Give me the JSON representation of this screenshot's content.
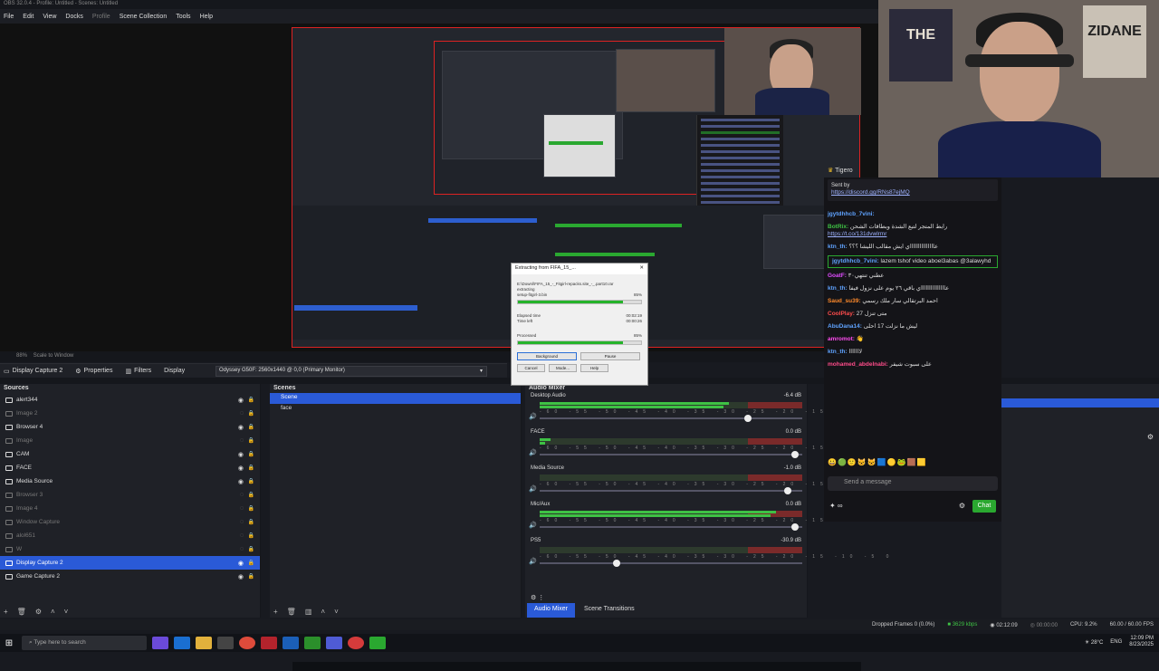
{
  "window": {
    "title": "OBS 32.0.4 - Profile: Untitled - Scenes: Untitled"
  },
  "menu": {
    "items": [
      {
        "label": "File",
        "enabled": true
      },
      {
        "label": "Edit",
        "enabled": true
      },
      {
        "label": "View",
        "enabled": true
      },
      {
        "label": "Docks",
        "enabled": true
      },
      {
        "label": "Profile",
        "enabled": false
      },
      {
        "label": "Scene Collection",
        "enabled": true
      },
      {
        "label": "Tools",
        "enabled": true
      },
      {
        "label": "Help",
        "enabled": true
      }
    ]
  },
  "preview": {
    "zoom_label": "88%",
    "scale_label": "Scale to Window"
  },
  "toolbar": {
    "source_name": "Display Capture 2",
    "properties_label": "Properties",
    "filters_label": "Filters",
    "display_label": "Display",
    "display_value": "Odyssey G50F: 2560x1440 @ 0,0 (Primary Monitor)"
  },
  "sources": {
    "title": "Sources",
    "items": [
      {
        "label": "alert344",
        "visible": true,
        "selected": false
      },
      {
        "label": "Image 2",
        "visible": false,
        "selected": false
      },
      {
        "label": "Browser 4",
        "visible": true,
        "selected": false
      },
      {
        "label": "Image",
        "visible": false,
        "selected": false
      },
      {
        "label": "CAM",
        "visible": true,
        "selected": false
      },
      {
        "label": "FACE",
        "visible": true,
        "selected": false
      },
      {
        "label": "Media Source",
        "visible": true,
        "selected": false
      },
      {
        "label": "Browser 3",
        "visible": false,
        "selected": false
      },
      {
        "label": "Image 4",
        "visible": false,
        "selected": false
      },
      {
        "label": "Window Capture",
        "visible": false,
        "selected": false
      },
      {
        "label": "alol651",
        "visible": false,
        "selected": false
      },
      {
        "label": "W",
        "visible": false,
        "selected": false
      },
      {
        "label": "Display Capture 2",
        "visible": true,
        "selected": true
      },
      {
        "label": "Game Capture 2",
        "visible": true,
        "selected": false
      }
    ]
  },
  "scenes": {
    "title": "Scenes",
    "items": [
      {
        "label": "Scene",
        "selected": true
      },
      {
        "label": "face",
        "selected": false
      }
    ]
  },
  "mixer": {
    "title": "Audio Mixer",
    "channels": [
      {
        "name": "Desktop Audio",
        "db": "-6.4 dB",
        "level": 0.72,
        "fader": 0.78
      },
      {
        "name": "FACE",
        "db": "0.0 dB",
        "level": 0.04,
        "fader": 0.96
      },
      {
        "name": "Media Source",
        "db": "-1.0 dB",
        "level": 0.0,
        "fader": 0.93
      },
      {
        "name": "Mic/Aux",
        "db": "0.0 dB",
        "level": 0.9,
        "fader": 0.96
      },
      {
        "name": "PS5",
        "db": "-30.9 dB",
        "level": 0.0,
        "fader": 0.28
      }
    ],
    "scale": "-60 -55 -50 -45 -40 -35 -30 -25 -20 -15 -10 -5 0",
    "tabs": [
      "Audio Mixer",
      "Scene Transitions"
    ]
  },
  "dialog": {
    "title": "Extracting from FIFA_15_...",
    "archive": "E:\\Downl\\FIFA_15_-_Fitgirl-repacks.site_-_.part10.rar",
    "action": "extracting",
    "file": "setup-fitgirl-3.bin",
    "file_percent": "85%",
    "file_progress": 0.85,
    "elapsed_label": "Elapsed time",
    "elapsed_value": "00:02:19",
    "left_label": "Time left",
    "left_value": "00:00:26",
    "processed_label": "Processed",
    "processed_percent": "85%",
    "processed_progress": 0.85,
    "buttons": [
      "Background",
      "Pause",
      "Cancel",
      "Mode...",
      "Help"
    ]
  },
  "chat": {
    "channel": "Tigero",
    "pinned_by": "Sent by",
    "pinned_link": "https://discord.gg/RNs87ejMQ",
    "messages": [
      {
        "user": "jgytdhhcb_7vini:",
        "text": "",
        "color": "#5fa3ff",
        "highlight": false
      },
      {
        "user": "BotRix:",
        "text": "رابط المتجر لتبع الشدة وبطاقات الشحن",
        "link": "https://t.co/131dvwlrmr",
        "color": "#3ec144",
        "highlight": false
      },
      {
        "user": "ktn_th:",
        "text": "عاااااااااااااااي ايش مقالب الليشا ؟؟؟",
        "color": "#5fa3ff",
        "highlight": false
      },
      {
        "user": "jgytdhhcb_7vini:",
        "text": "lazem tshof video aboel3abas @3alawyhd",
        "color": "#5fa3ff",
        "highlight": true
      },
      {
        "user": "GoatF:",
        "text": "عطني تنتهي٣٠",
        "color": "#e04cff",
        "highlight": false
      },
      {
        "user": "ktn_th:",
        "text": "عاااااااااااااااي باقي ٢٦ يوم على نزول فيفا",
        "color": "#5fa3ff",
        "highlight": false
      },
      {
        "user": "Saud_su39:",
        "text": "احمد البرتقالي سار ملك رسمي",
        "color": "#ff8a2b",
        "highlight": false
      },
      {
        "user": "CoolPlay:",
        "text": "متى تنزل 27",
        "color": "#ff4c4c",
        "highlight": false
      },
      {
        "user": "AbuDana14:",
        "text": "ليش ما نزلت 17 احلى",
        "color": "#5fa3ff",
        "highlight": false
      },
      {
        "user": "amromot:",
        "text": "👋",
        "color": "#ff4cf0",
        "highlight": false
      },
      {
        "user": "ktn_th:",
        "text": "لااااااا",
        "color": "#5fa3ff",
        "highlight": false
      },
      {
        "user": "mohamed_abdelnabi:",
        "text": "على سبوت شيفر",
        "color": "#ff4c8a",
        "highlight": false
      }
    ],
    "input_placeholder": "Send a message",
    "send_label": "Chat"
  },
  "webcam": {
    "poster_left": "THE",
    "poster_right": "ZIDANE"
  },
  "status": {
    "dropped": "Dropped Frames 0 (0.0%)",
    "kbps": "3629 kbps",
    "live_time": "02:12:09",
    "rec_time": "00:00:00",
    "cpu": "CPU: 9.2%",
    "fps": "60.00 / 60.00 FPS"
  },
  "taskbar": {
    "search_placeholder": "Type here to search",
    "weather": "28°C",
    "lang": "ENG",
    "time": "12:09 PM",
    "date": "8/23/2025"
  }
}
